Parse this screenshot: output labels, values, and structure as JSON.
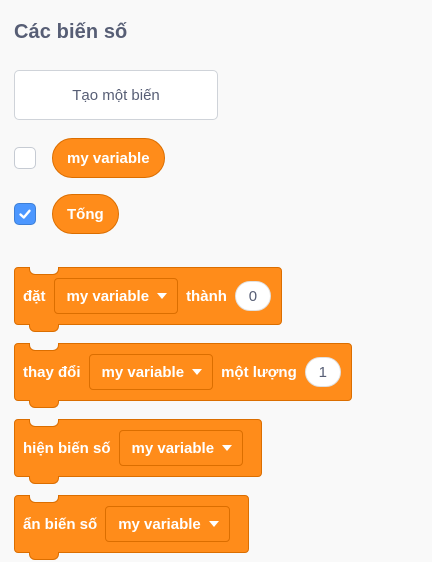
{
  "category": {
    "title": "Các biến số"
  },
  "make_variable_button": {
    "label": "Tạo một biến"
  },
  "variables": [
    {
      "name": "my variable",
      "checked": false
    },
    {
      "name": "Tống",
      "checked": true
    }
  ],
  "blocks": {
    "set": {
      "prefix": "đặt",
      "variable": "my variable",
      "middle": "thành",
      "value": "0"
    },
    "change": {
      "prefix": "thay đổi",
      "variable": "my variable",
      "middle": "một lượng",
      "value": "1"
    },
    "show": {
      "prefix": "hiện biến số",
      "variable": "my variable"
    },
    "hide": {
      "prefix": "ẩn biến số",
      "variable": "my variable"
    }
  },
  "colors": {
    "variables_block": "#ff8c1a",
    "variables_block_border": "#db6e00",
    "checkbox_checked": "#4c97ff",
    "text_muted": "#575e75"
  },
  "icons": {
    "checkbox_check": "check-icon",
    "dropdown": "dropdown-arrow-icon"
  }
}
